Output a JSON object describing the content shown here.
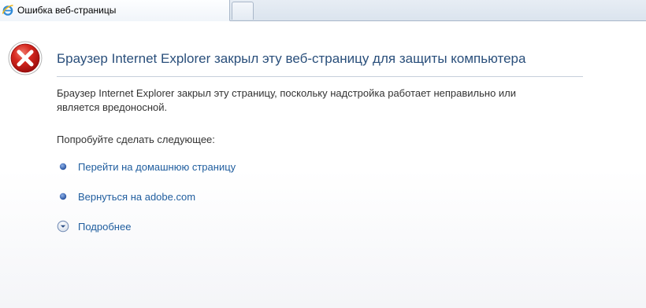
{
  "tab": {
    "title": "Ошибка веб-страницы",
    "icon": "ie-logo-icon"
  },
  "page": {
    "heading": "Браузер Internet Explorer закрыл эту веб-страницу для защиты компьютера",
    "description": "Браузер Internet Explorer закрыл эту страницу, поскольку надстройка работает неправильно или является вредоносной.",
    "try_label": "Попробуйте сделать следующее:",
    "links": {
      "home": "Перейти на домашнюю страницу",
      "back": "Вернуться на adobe.com",
      "more": "Подробнее"
    }
  },
  "colors": {
    "heading": "#2a4f7b",
    "link": "#1f5d9e",
    "error_red": "#c8161d",
    "bullet": "#2b5fb0"
  }
}
